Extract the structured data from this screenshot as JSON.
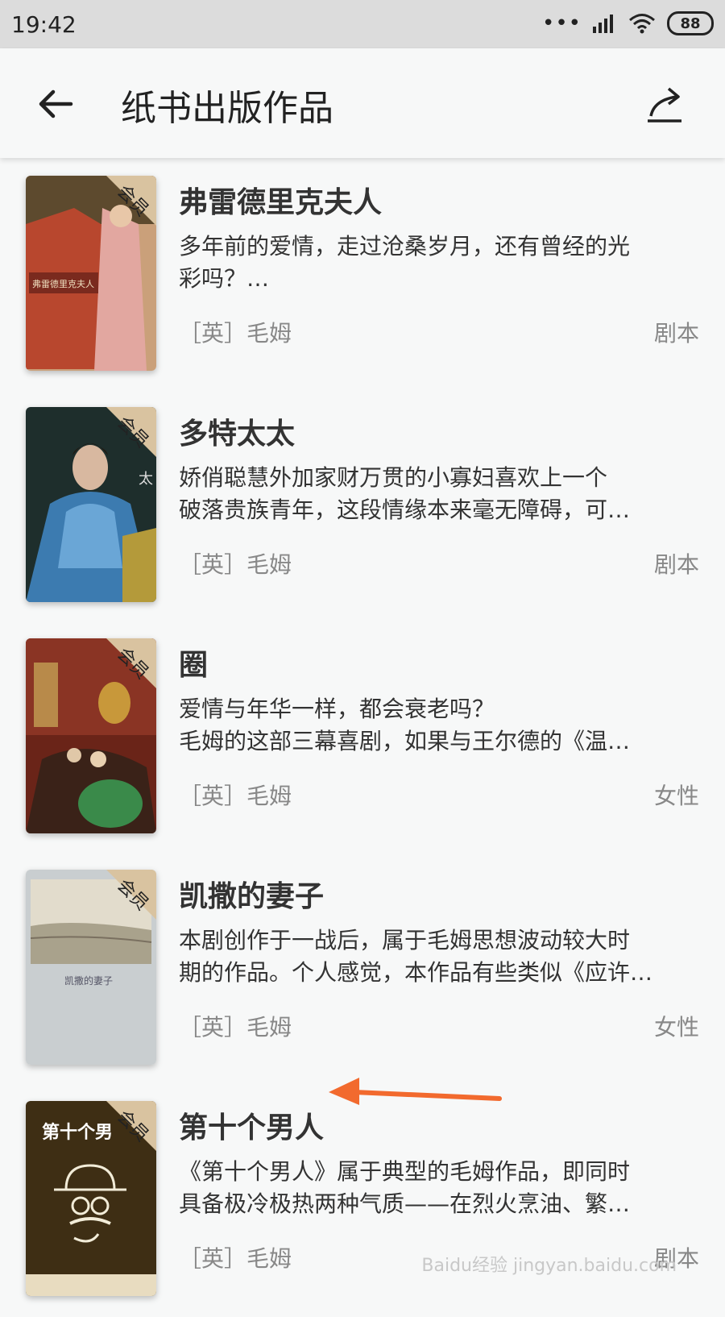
{
  "status_bar": {
    "time": "19:42",
    "battery": "88"
  },
  "header": {
    "title": "纸书出版作品"
  },
  "badge": "会员",
  "books": [
    {
      "title": "弗雷德里克夫人",
      "description": "多年前的爱情，走过沧桑岁月，还有曾经的光\n彩吗？…",
      "author": "［英］毛姆",
      "category": "剧本",
      "cover_text": "弗雷德里克夫人"
    },
    {
      "title": "多特太太",
      "description": "娇俏聪慧外加家财万贯的小寡妇喜欢上一个\n破落贵族青年，这段情缘本来毫无障碍，可…",
      "author": "［英］毛姆",
      "category": "剧本",
      "cover_text": "太"
    },
    {
      "title": "圈",
      "description": "爱情与年华一样，都会衰老吗？\n毛姆的这部三幕喜剧，如果与王尔德的《温…",
      "author": "［英］毛姆",
      "category": "女性",
      "cover_text": ""
    },
    {
      "title": "凯撒的妻子",
      "description": "本剧创作于一战后，属于毛姆思想波动较大时\n期的作品。个人感觉，本作品有些类似《应许…",
      "author": "［英］毛姆",
      "category": "女性",
      "cover_text": "凯撒的妻子"
    },
    {
      "title": "第十个男人",
      "description": "《第十个男人》属于典型的毛姆作品，即同时\n具备极冷极热两种气质——在烈火烹油、繁…",
      "author": "［英］毛姆",
      "category": "剧本",
      "cover_text": "第十个男"
    }
  ],
  "watermark": "Baidu经验 jingyan.baidu.com",
  "colors": {
    "arrow": "#f26a2e",
    "badge_bg": "#d9c3a0"
  },
  "icons": [
    "back-arrow-icon",
    "share-icon",
    "signal-icon",
    "wifi-icon"
  ]
}
